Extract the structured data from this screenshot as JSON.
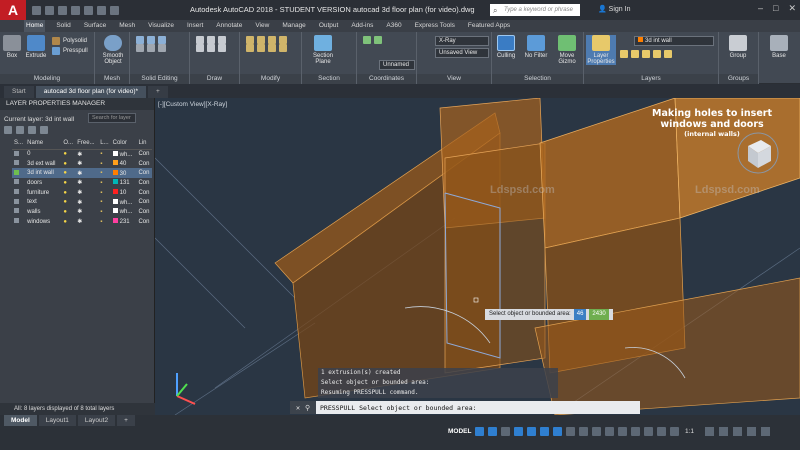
{
  "app": {
    "logo": "A",
    "title": "Autodesk AutoCAD 2018 - STUDENT VERSION    autocad 3d floor plan (for video).dwg",
    "search_placeholder": "Type a keyword or phrase",
    "signin": "Sign In"
  },
  "menu_tabs": [
    "Home",
    "Solid",
    "Surface",
    "Mesh",
    "Visualize",
    "Insert",
    "Annotate",
    "View",
    "Manage",
    "Output",
    "Add-ins",
    "A360",
    "Express Tools",
    "Featured Apps"
  ],
  "ribbon": {
    "box": "Box",
    "extrude": "Extrude",
    "polysolid": "Polysolid",
    "presspull": "Presspull",
    "smooth_object": "Smooth Object",
    "section_plane": "Section Plane",
    "unnamed": "Unnamed",
    "visual_style": "X-Ray",
    "view_state": "Unsaved View",
    "culling": "Culling",
    "no_filter": "No Filter",
    "move_gizmo": "Move Gizmo",
    "layer_properties": "Layer Properties",
    "current_layer": "3d int wall",
    "group": "Group",
    "base": "Base",
    "panels": {
      "modeling": "Modeling",
      "mesh": "Mesh",
      "solid_editing": "Solid Editing",
      "draw": "Draw",
      "modify": "Modify",
      "section": "Section",
      "coordinates": "Coordinates",
      "view": "View",
      "selection": "Selection",
      "layers": "Layers",
      "groups": "Groups"
    }
  },
  "doc_tabs": [
    "Start",
    "autocad 3d floor plan (for video)*"
  ],
  "layer_panel": {
    "title": "LAYER PROPERTIES MANAGER",
    "current": "Current layer: 3d int wall",
    "search_placeholder": "Search for layer",
    "columns": [
      "S...",
      "Name",
      "O...",
      "Free...",
      "L...",
      "Color",
      "Lin"
    ],
    "layers": [
      {
        "name": "0",
        "color_name": "wh...",
        "color": "#ffffff",
        "linetype": "Con"
      },
      {
        "name": "3d ext wall",
        "color_name": "40",
        "color": "#ff9f1c",
        "linetype": "Con"
      },
      {
        "name": "3d int wall",
        "color_name": "30",
        "color": "#ff7f00",
        "linetype": "Con"
      },
      {
        "name": "doors",
        "color_name": "131",
        "color": "#00b7b7",
        "linetype": "Con"
      },
      {
        "name": "furniture",
        "color_name": "10",
        "color": "#ff2020",
        "linetype": "Con"
      },
      {
        "name": "text",
        "color_name": "wh...",
        "color": "#ffffff",
        "linetype": "Con"
      },
      {
        "name": "walls",
        "color_name": "wh...",
        "color": "#ffffff",
        "linetype": "Con"
      },
      {
        "name": "windows",
        "color_name": "231",
        "color": "#ff3fa0",
        "linetype": "Con"
      }
    ],
    "footer": "All: 8 layers displayed of 8 total layers"
  },
  "viewport": {
    "label": "[-][Custom View][X-Ray]",
    "overlay_l1": "Making holes to insert",
    "overlay_l2": "windows and doors",
    "overlay_l3": "(internal walls)",
    "watermark1": "Ldspsd.com",
    "watermark2": "Ldspsd.com",
    "tooltip_label": "Select object or bounded area:",
    "tooltip_v1": "46",
    "tooltip_v2": "2430"
  },
  "command": {
    "history": [
      "1 extrusion(s) created",
      "Select object or bounded area:",
      "Resuming PRESSPULL command."
    ],
    "current": "PRESSPULL Select object or bounded area:"
  },
  "status": {
    "layout_tabs": [
      "Model",
      "Layout1",
      "Layout2"
    ],
    "model_label": "MODEL",
    "scale": "1:1"
  }
}
